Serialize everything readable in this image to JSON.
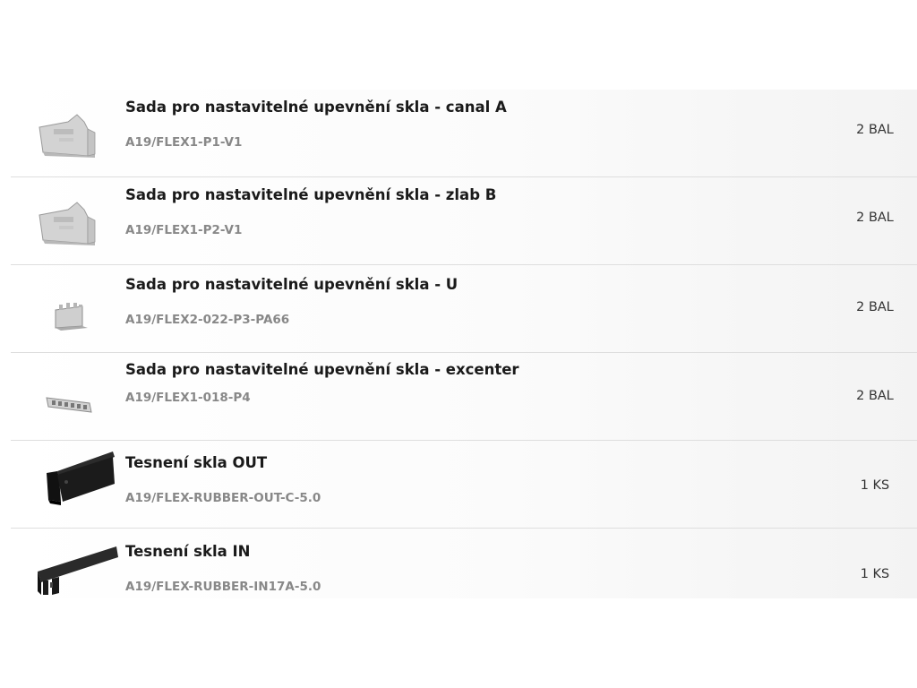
{
  "items": [
    {
      "name": "Sada pro nastavitelné upevnění skla - canal A",
      "code": "A19/FLEX1-P1-V1",
      "qty": "2 BAL",
      "image": "adjustable-clamp-icon"
    },
    {
      "name": "Sada pro nastavitelné upevnění skla - zlab B",
      "code": "A19/FLEX1-P2-V1",
      "qty": "2 BAL",
      "image": "adjustable-clamp-icon"
    },
    {
      "name": "Sada pro nastavitelné upevnění skla - U",
      "code": "A19/FLEX2-022-P3-PA66",
      "qty": "2 BAL",
      "image": "u-clip-icon"
    },
    {
      "name": "Sada pro nastavitelné upevnění skla - excenter",
      "code": "A19/FLEX1-018-P4",
      "qty": "2 BAL",
      "image": "eccentric-strip-icon"
    },
    {
      "name": "Tesnení skla OUT",
      "code": "A19/FLEX-RUBBER-OUT-C-5.0",
      "qty": "1 KS",
      "image": "rubber-seal-out-icon"
    },
    {
      "name": "Tesnení skla IN",
      "code": "A19/FLEX-RUBBER-IN17A-5.0",
      "qty": "1 KS",
      "image": "rubber-seal-in-icon"
    }
  ],
  "colors": {
    "text": "#1a1a1a",
    "code": "#888888",
    "divider": "#dedede"
  }
}
